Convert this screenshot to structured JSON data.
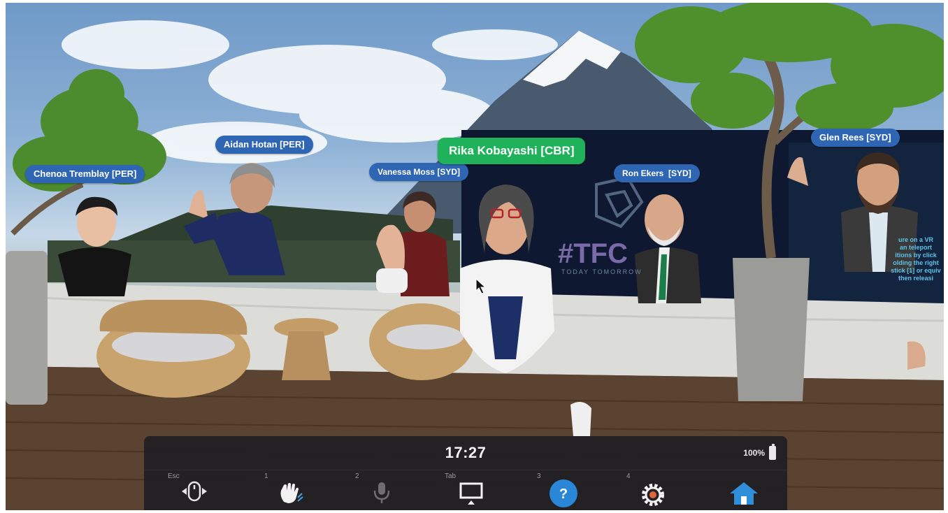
{
  "participants": [
    {
      "name": "Chenoa Tremblay [PER]"
    },
    {
      "name": "Aidan Hotan [PER]"
    },
    {
      "name": "Vanessa Moss [SYD]"
    },
    {
      "name": "Rika Kobayashi [CBR]",
      "speaking": true
    },
    {
      "name": "Ron Ekers  [SYD]"
    },
    {
      "name": "Glen Rees [SYD]"
    }
  ],
  "screen": {
    "logo_text": "#TFC",
    "logo_sub": "TODAY TOMORROW",
    "side_text": [
      "ure on a VR",
      "an teleport",
      "itions by click",
      "olding the right",
      "stick [1] or equiv",
      "then releasi"
    ]
  },
  "toolbar": {
    "time": "17:27",
    "battery": "100%",
    "buttons": [
      {
        "key": "Esc",
        "icon": "mouse-icon"
      },
      {
        "key": "1",
        "icon": "wave-hand-icon"
      },
      {
        "key": "2",
        "icon": "microphone-icon"
      },
      {
        "key": "Tab",
        "icon": "screen-icon"
      },
      {
        "key": "3",
        "icon": "help-icon"
      },
      {
        "key": "4",
        "icon": "settings-gear-icon"
      },
      {
        "key": "",
        "icon": "home-icon"
      }
    ]
  },
  "colors": {
    "name_tag": "#2f66b3",
    "active_tag": "#1fb25a",
    "toolbar": "#1e1e22",
    "help": "#2a86d6",
    "home": "#2f8fd8"
  }
}
